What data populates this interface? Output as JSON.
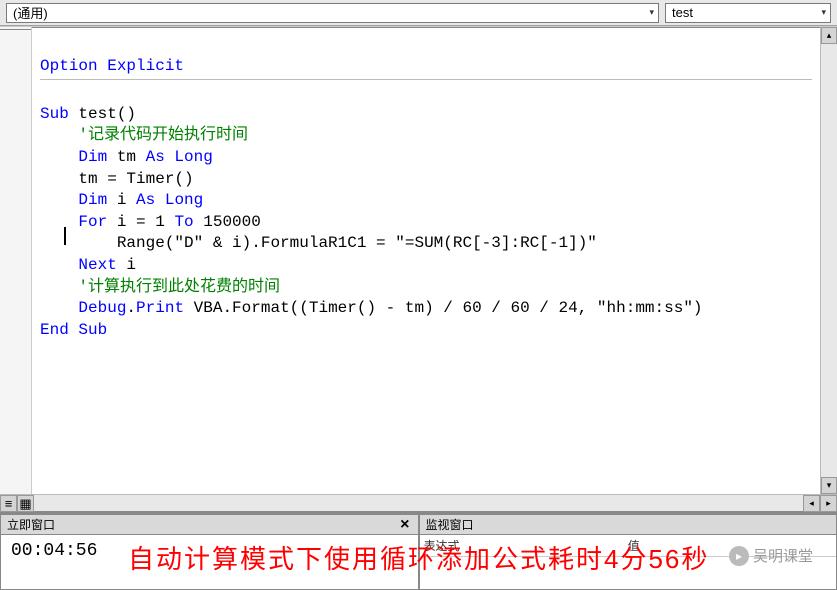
{
  "topbar": {
    "left_dropdown": "(通用)",
    "right_dropdown": "test"
  },
  "code": {
    "l1_kw": "Option Explicit",
    "l3_kw1": "Sub",
    "l3_id": " test()",
    "l4_cm": "    '记录代码开始执行时间",
    "l5_kw1": "    Dim",
    "l5_id": " tm ",
    "l5_kw2": "As Long",
    "l6_id": "    tm = Timer()",
    "l7_kw1": "    Dim",
    "l7_id": " i ",
    "l7_kw2": "As Long",
    "l8_kw1": "    For",
    "l8_id": " i = 1 ",
    "l8_kw2": "To",
    "l8_id2": " 150000",
    "l9_id": "        Range(\"D\" & i).FormulaR1C1 = \"=SUM(RC[-3]:RC[-1])\"",
    "l10_kw1": "    Next",
    "l10_id": " i",
    "l11_cm": "    '计算执行到此处花费的时间",
    "l12_kw1": "    Debug",
    "l12_id": ".",
    "l12_kw2": "Print",
    "l12_id2": " VBA.Format((Timer() - tm) / 60 / 60 / 24, \"hh:mm:ss\")",
    "l13_kw": "End Sub"
  },
  "panels": {
    "immediate_title": "立即窗口",
    "immediate_output": " 00:04:56",
    "watch_title": "监视窗口",
    "watch_col1": "表达式",
    "watch_col2": "值"
  },
  "overlay": "自动计算模式下使用循环添加公式耗时4分56秒",
  "watermark": "吴明课堂"
}
